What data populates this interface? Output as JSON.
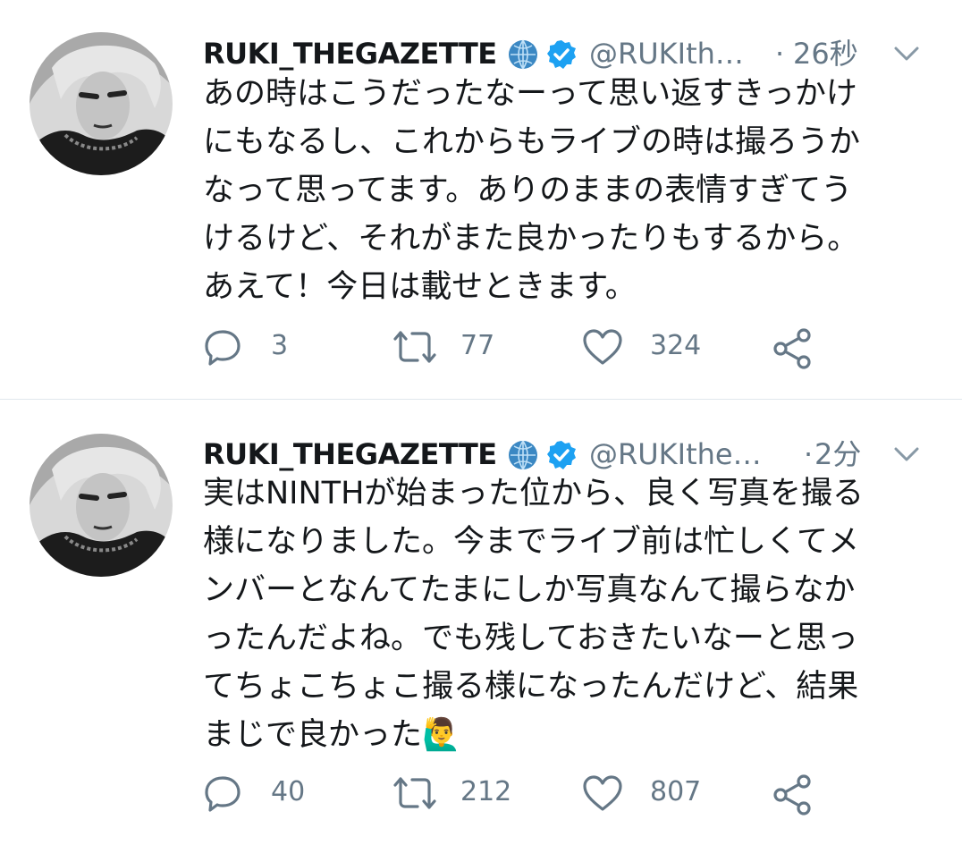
{
  "tweets": [
    {
      "display_name": "RUKI_THEGAZETTE",
      "handle": "@RUKIth…",
      "separator": "·",
      "time": "26秒",
      "body": "あの時はこうだったなーって思い返すきっかけ\nにもなるし、これからもライブの時は撮ろうか\nなって思ってます。ありのままの表情すぎてう\nけるけど、それがまた良かったりもするから。\nあえて！今日は載せときます。",
      "emoji": "",
      "replies": "3",
      "retweets": "77",
      "likes": "324"
    },
    {
      "display_name": "RUKI_THEGAZETTE",
      "handle": "@RUKIthe…",
      "separator": "·",
      "time": "2分",
      "body": "実はNINTHが始まった位から、良く写真を撮る\n様になりました。今までライブ前は忙しくてメ\nンバーとなんてたまにしか写真なんて撮らなか\nったんだよね。でも残しておきたいなーと思っ\nてちょこちょこ撮る様になったんだけど、結果\nまじで良かった",
      "emoji": "🙋‍♂️",
      "replies": "40",
      "retweets": "212",
      "likes": "807"
    }
  ],
  "icons": {
    "globe": "globe-icon",
    "verified": "verified-badge-icon",
    "menu": "chevron-down-icon",
    "reply": "reply-icon",
    "retweet": "retweet-icon",
    "like": "heart-icon",
    "share": "share-icon"
  },
  "colors": {
    "text": "#14171a",
    "secondary": "#657786",
    "verified": "#1da1f2",
    "divider": "#e1e8ed"
  }
}
